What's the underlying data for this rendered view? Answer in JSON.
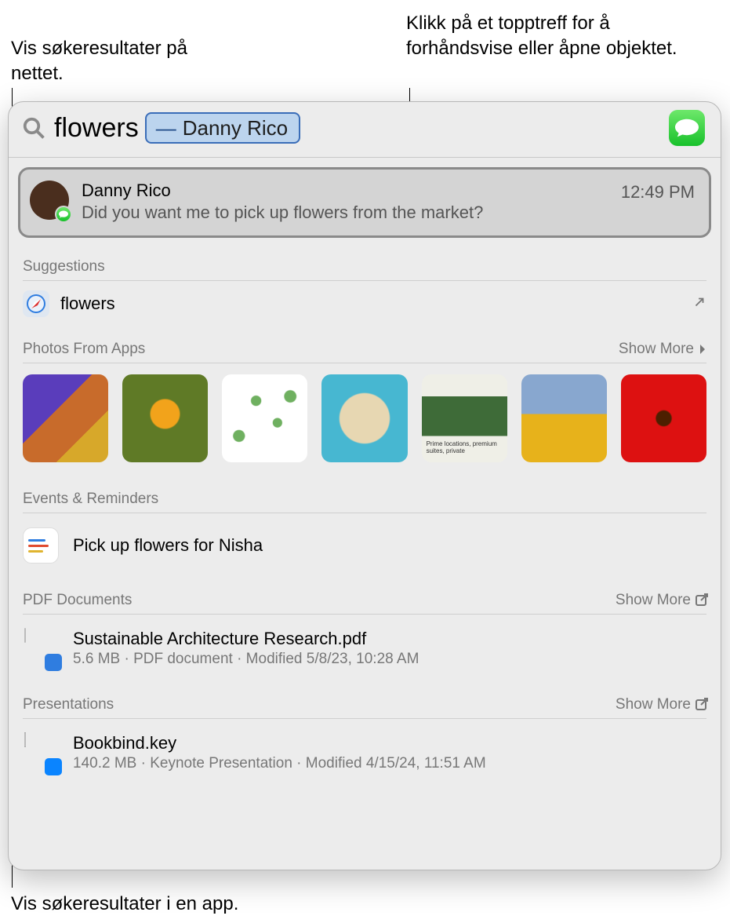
{
  "callouts": {
    "web": "Vis søkeresultater på nettet.",
    "top": "Klikk på et topptreff for å forhåndsvise eller åpne objektet.",
    "app": "Vis søkeresultater i en app."
  },
  "search": {
    "query": "flowers",
    "token_prefix": "—",
    "token_name": "Danny Rico"
  },
  "top_hit": {
    "name": "Danny Rico",
    "message": "Did you want me to pick up flowers from the market?",
    "time": "12:49 PM"
  },
  "sections": {
    "suggestions": {
      "header": "Suggestions",
      "item": "flowers"
    },
    "photos": {
      "header": "Photos From Apps",
      "show_more": "Show More"
    },
    "events": {
      "header": "Events & Reminders",
      "item": "Pick up flowers for Nisha"
    },
    "pdf": {
      "header": "PDF Documents",
      "show_more": "Show More",
      "doc": {
        "title": "Sustainable Architecture Research.pdf",
        "meta": "5.6 MB · PDF document · Modified 5/8/23, 10:28 AM"
      }
    },
    "presentations": {
      "header": "Presentations",
      "show_more": "Show More",
      "doc": {
        "title": "Bookbind.key",
        "meta": "140.2 MB · Keynote Presentation · Modified 4/15/24, 11:51 AM"
      }
    }
  }
}
